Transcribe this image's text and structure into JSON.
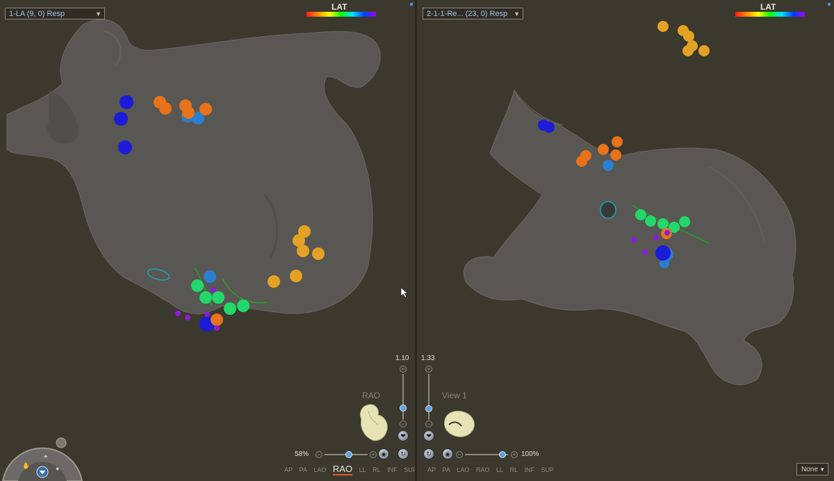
{
  "left_view": {
    "map_select": "1-LA (9, 0) Resp",
    "legend_title": "LAT",
    "zoom_value": "1.10",
    "view_label": "RAO",
    "zoom_percent": "58%",
    "view_buttons": [
      "AP",
      "PA",
      "LAO",
      "RAO",
      "LL",
      "RL",
      "INF",
      "SUP"
    ],
    "active_view": "RAO"
  },
  "right_view": {
    "map_select": "2-1-1-Re... (23, 0) Resp",
    "legend_title": "LAT",
    "zoom_value": "1.33",
    "view_label": "View 1",
    "zoom_percent": "100%",
    "view_buttons": [
      "AP",
      "PA",
      "LAO",
      "RAO",
      "LL",
      "RL",
      "INF",
      "SUP"
    ]
  },
  "bottom_right_select": "None",
  "colors": {
    "background": "#3b382e",
    "anatomy": "#5a5855",
    "accent_blue": "#5aa0e0",
    "active_underline": "#e05a2a"
  }
}
